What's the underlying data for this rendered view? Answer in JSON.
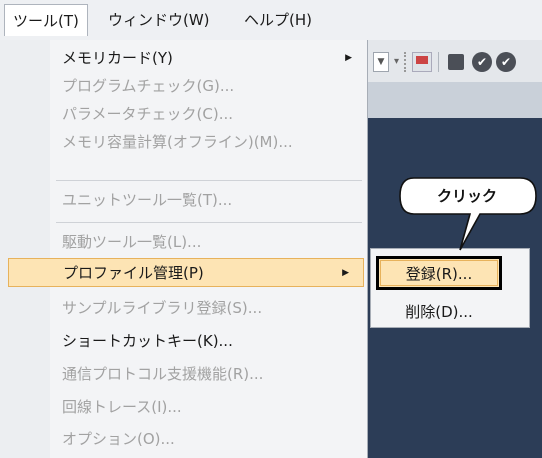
{
  "menubar": {
    "items": [
      {
        "label": "ツール(T)"
      },
      {
        "label": "ウィンドウ(W)"
      },
      {
        "label": "ヘルプ(H)"
      }
    ]
  },
  "tools_menu": {
    "items": [
      {
        "label": "メモリカード(Y)"
      },
      {
        "label": "プログラムチェック(G)..."
      },
      {
        "label": "パラメータチェック(C)..."
      },
      {
        "label": "メモリ容量計算(オフライン)(M)..."
      },
      {
        "label": "ユニットツール一覧(T)..."
      },
      {
        "label": "駆動ツール一覧(L)..."
      },
      {
        "label": "プロファイル管理(P)"
      },
      {
        "label": "サンプルライブラリ登録(S)..."
      },
      {
        "label": "ショートカットキー(K)..."
      },
      {
        "label": "通信プロトコル支援機能(R)..."
      },
      {
        "label": "回線トレース(I)..."
      },
      {
        "label": "オプション(O)..."
      }
    ],
    "submenu_arrow": "▶"
  },
  "profile_submenu": {
    "register_label": "登録(R)...",
    "delete_label": "削除(D)..."
  },
  "callout": {
    "text": "クリック"
  },
  "toolbar": {
    "icons": [
      "dropdown-icon",
      "overflow-icon",
      "monitor-icon",
      "stop-icon",
      "check-icon",
      "check-icon"
    ]
  },
  "colors": {
    "highlight_fill": "#fde4b4",
    "highlight_border": "#e7b25c",
    "disabled_text": "#a2a2a2",
    "background_dark": "#2c3d57"
  }
}
